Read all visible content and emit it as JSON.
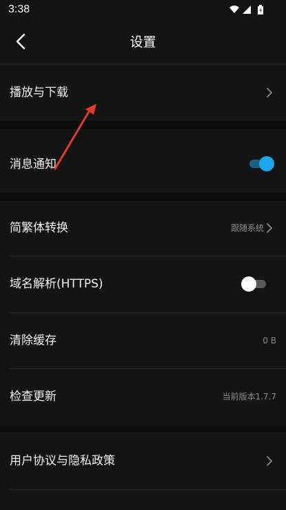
{
  "status_bar": {
    "time": "3:38",
    "icons": [
      "wifi-icon",
      "signal-icon",
      "battery-icon"
    ]
  },
  "header": {
    "title": "设置",
    "back_icon": "chevron-left-icon"
  },
  "settings": {
    "playback_download": {
      "label": "播放与下载"
    },
    "notifications": {
      "label": "消息通知",
      "enabled": true
    },
    "script_conversion": {
      "label": "简繁体转换",
      "value": "跟随系统"
    },
    "dns_https": {
      "label": "域名解析(HTTPS)",
      "enabled": false
    },
    "clear_cache": {
      "label": "清除缓存",
      "value": "0 B"
    },
    "check_update": {
      "label": "检查更新",
      "value": "当前版本1.7.7"
    },
    "user_agreement": {
      "label": "用户协议与隐私政策"
    }
  },
  "colors": {
    "background": "#141414",
    "section_gap": "#0c0c0c",
    "toggle_on_knob": "#1aa7ec",
    "toggle_on_track": "#1a5f86",
    "toggle_off_knob": "#ffffff",
    "toggle_off_track": "#5a5a5a",
    "annotation_arrow": "#e23a2a"
  }
}
